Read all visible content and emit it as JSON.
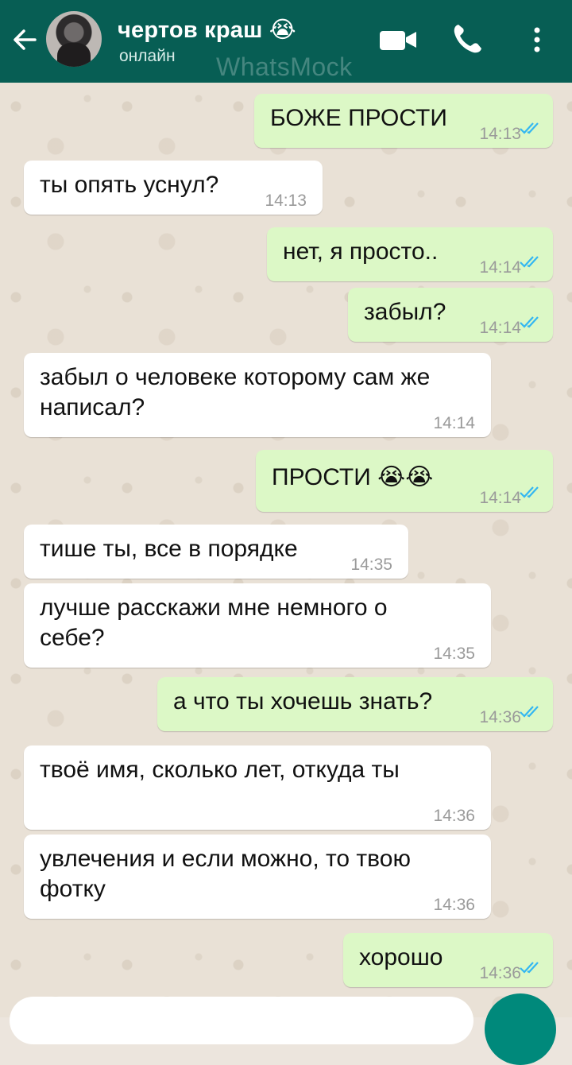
{
  "header": {
    "contact_name": "чертов краш",
    "contact_emoji": "😭",
    "status": "онлайн",
    "watermark": "WhatsMock",
    "icons": [
      "back-arrow-icon",
      "video-call-icon",
      "phone-icon",
      "more-options-icon"
    ]
  },
  "colors": {
    "header": "#075e54",
    "incoming": "#ffffff",
    "outgoing": "#dcf8c6",
    "read_ticks": "#34b7f1"
  },
  "messages": [
    {
      "dir": "out",
      "text": "БОЖЕ ПРОСТИ",
      "time": "14:13"
    },
    {
      "dir": "in",
      "text": "ты опять уснул?",
      "time": "14:13"
    },
    {
      "dir": "out",
      "text": "нет, я просто..",
      "time": "14:14"
    },
    {
      "dir": "out",
      "text": "забыл?",
      "time": "14:14"
    },
    {
      "dir": "in",
      "text": "забыл о человеке которому сам же написал?",
      "time": "14:14"
    },
    {
      "dir": "out",
      "text": "ПРОСТИ 😭😭",
      "time": "14:14"
    },
    {
      "dir": "in",
      "text": "тише ты, все в порядке",
      "time": "14:35"
    },
    {
      "dir": "in",
      "text": "лучше расскажи мне немного о себе?",
      "time": "14:35"
    },
    {
      "dir": "out",
      "text": "а что ты хочешь знать?",
      "time": "14:36"
    },
    {
      "dir": "in",
      "text": "твоё имя, сколько лет, откуда ты",
      "time": "14:36"
    },
    {
      "dir": "in",
      "text": "увлечения и если можно, то твою фотку",
      "time": "14:36"
    },
    {
      "dir": "out",
      "text": "хорошо",
      "time": "14:36"
    }
  ]
}
